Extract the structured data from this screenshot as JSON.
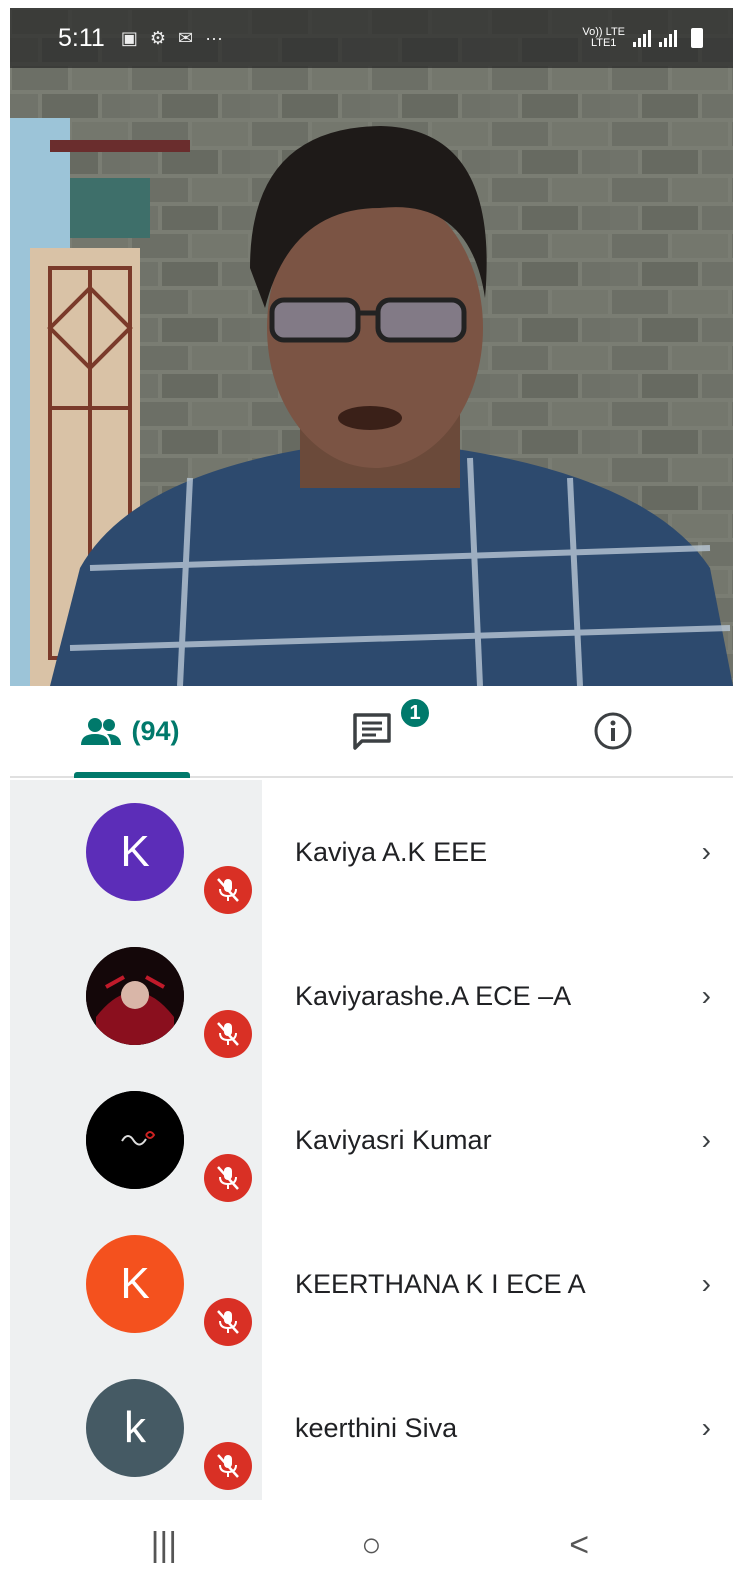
{
  "status_bar": {
    "time": "5:11",
    "icons": [
      "image-icon",
      "tractor-icon",
      "mail-icon",
      "more-icon"
    ],
    "network": "LTE",
    "network_sub": "LTE1",
    "volte": "Vo))"
  },
  "video": {
    "subject": "presenter-video"
  },
  "tabs": {
    "people_count": "(94)",
    "chat_badge": "1",
    "icons": [
      "people-icon",
      "chat-icon",
      "info-icon"
    ]
  },
  "participants": [
    {
      "name": "Kaviya A.K EEE",
      "initial": "K",
      "avatar_color": "#5c2db8",
      "muted": true
    },
    {
      "name": "Kaviyarashe.A ECE –A",
      "initial": "",
      "avatar_color": "#1a0d10",
      "muted": true
    },
    {
      "name": "Kaviyasri Kumar",
      "initial": "",
      "avatar_color": "#000000",
      "muted": true
    },
    {
      "name": "KEERTHANA K I ECE A",
      "initial": "K",
      "avatar_color": "#f4511e",
      "muted": true
    },
    {
      "name": "keerthini Siva",
      "initial": "k",
      "avatar_color": "#455a64",
      "muted": true
    }
  ],
  "nav": {
    "recents": "|||",
    "home": "○",
    "back": "<"
  },
  "colors": {
    "accent": "#00796b",
    "mute_red": "#d93025"
  }
}
